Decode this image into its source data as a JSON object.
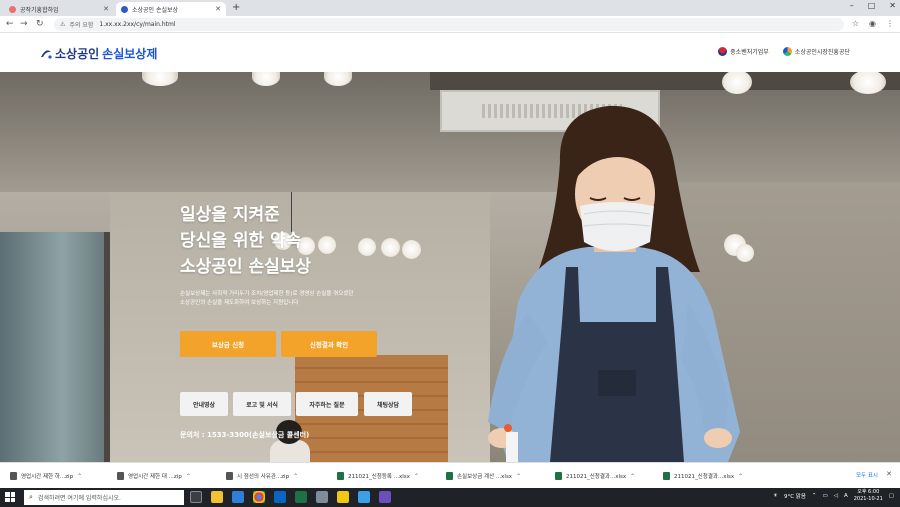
{
  "browser": {
    "tabs": [
      {
        "title": "공작기흥합하임",
        "active": false
      },
      {
        "title": "소상공인 손실보상",
        "active": true
      }
    ],
    "new_tab_symbol": "+",
    "security_label": "주의 요함",
    "url": "1.xx.xx.2xx/cy/main.html",
    "window_controls": [
      "–",
      "□",
      "✕"
    ]
  },
  "site": {
    "logo_part1": "소상공인",
    "logo_part2": "손실보상제",
    "partners": [
      "중소벤처기업부",
      "소상공인시장진흥공단"
    ]
  },
  "hero": {
    "headline": [
      "일상을 지켜준",
      "당신을 위한 약속",
      "소상공인 손실보상"
    ],
    "description": [
      "손실보상제는 사회적 거리두기 조치(영업제한 등)로 경영상 손실을 겪으셨던",
      "소상공인의 손실을 제도화하여 보상하는 지원입니다"
    ],
    "cta_primary": "보상금 신청",
    "cta_secondary": "신청결과 확인",
    "secondary_buttons": [
      "안내영상",
      "로고 및 서식",
      "자주하는 질문",
      "채팅상담"
    ],
    "contact": "문의처 : 1533-3300(손실보상금 콜센터)"
  },
  "downloads": {
    "items": [
      {
        "name": "영업시간 제한 하...zip"
      },
      {
        "name": "영업시간 제한 대 ...zip"
      },
      {
        "name": "시 점선의 사유관...zip"
      },
      {
        "name": "211021_신청등록 ...xlsx"
      },
      {
        "name": "손실보상금 계산 ...xlsx"
      },
      {
        "name": "211021_신청결과...xlsx"
      },
      {
        "name": "211021_신청결과...xlsx"
      }
    ],
    "show_all": "모두 표시",
    "close_symbol": "✕"
  },
  "taskbar": {
    "search_placeholder": "검색하려면 여기에 입력하십시오.",
    "weather": "9°C 맑음",
    "time": "오후 6:00",
    "date": "2021-10-21"
  },
  "colors": {
    "accent_orange": "#f4a32a",
    "logo_navy": "#1f3a8a",
    "logo_blue": "#1a56db"
  }
}
